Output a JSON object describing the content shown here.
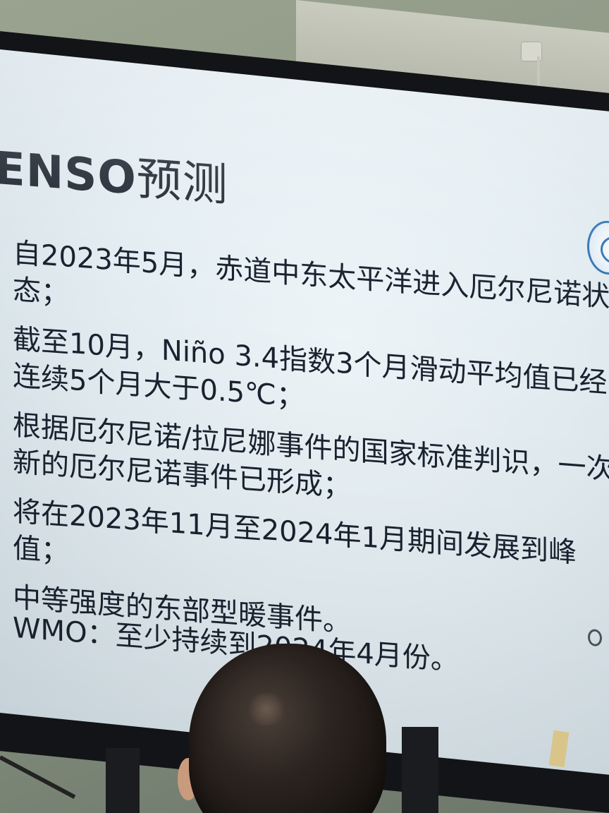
{
  "slide": {
    "title_latin": "ENSO",
    "title_cn": "预测",
    "bullets": [
      "自2023年5月，赤道中东太平洋进入厄尔尼诺状态；",
      "截至10月，Niño 3.4指数3个月滑动平均值已经连续5个月大于0.5℃；",
      "根据厄尔尼诺/拉尼娜事件的国家标准判识，一次新的厄尔尼诺事件已形成；",
      "将在2023年11月至2024年1月期间发展到峰值；",
      "中等强度的东部型暖事件。"
    ],
    "footer": "WMO：至少持续到2024年4月份。"
  }
}
